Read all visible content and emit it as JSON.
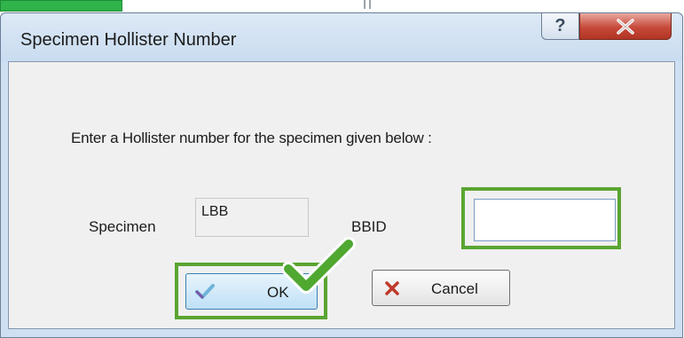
{
  "window": {
    "title": "Specimen Hollister Number",
    "help_glyph": "?",
    "close_icon": "close-icon"
  },
  "form": {
    "prompt": "Enter a Hollister number for the specimen given below :",
    "specimen_label": "Specimen",
    "specimen_value": "LBB",
    "bbid_label": "BBID",
    "bbid_value": ""
  },
  "buttons": {
    "ok_label": "OK",
    "ok_icon": "checkmark-icon",
    "cancel_label": "Cancel",
    "cancel_icon": "x-icon"
  },
  "colors": {
    "highlight": "#5aa532",
    "close_button": "#c7493a",
    "titlebar": "#cfe0f2"
  }
}
